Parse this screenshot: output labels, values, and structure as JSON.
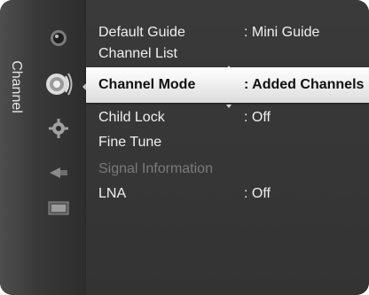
{
  "menu": {
    "category_label": "Channel",
    "category_icons": [
      "picture-icon",
      "channel-icon",
      "setup-icon",
      "input-icon",
      "application-icon"
    ],
    "items": [
      {
        "label": "Default Guide",
        "value": ": Mini Guide"
      },
      {
        "label": "Channel List",
        "value": ""
      },
      {
        "label": "Channel Mode",
        "value": ": Added Channels",
        "selected": true
      },
      {
        "label": "Child Lock",
        "value": ": Off"
      },
      {
        "label": "Fine Tune",
        "value": ""
      },
      {
        "label": "Signal Information",
        "value": "",
        "disabled": true
      },
      {
        "label": "LNA",
        "value": ": Off"
      }
    ]
  },
  "colors": {
    "background": "#3a3a3a",
    "highlight": "#f4f4f4",
    "text": "#f0f0f0",
    "disabled_text": "#7a7a7a"
  }
}
